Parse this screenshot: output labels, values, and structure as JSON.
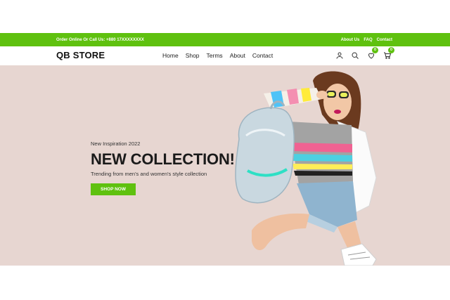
{
  "topbar": {
    "contact_text": "Order Online Or Call Us: +880 17XXXXXXXX",
    "links": [
      "About Us",
      "FAQ",
      "Contact"
    ]
  },
  "header": {
    "logo": "QB STORE",
    "menu": [
      "Home",
      "Shop",
      "Terms",
      "About",
      "Contact"
    ],
    "icons": [
      "user-icon",
      "search-icon",
      "heart-icon",
      "cart-icon"
    ],
    "wishlist_count": "0",
    "cart_count": "0"
  },
  "hero": {
    "kicker": "New Inspiration 2022",
    "title": "NEW COLLECTION!",
    "subtitle": "Trending from men's and women's style collection",
    "cta": "SHOP NOW"
  },
  "colors": {
    "accent": "#5fc10f",
    "hero_bg": "#e7d6d1"
  }
}
